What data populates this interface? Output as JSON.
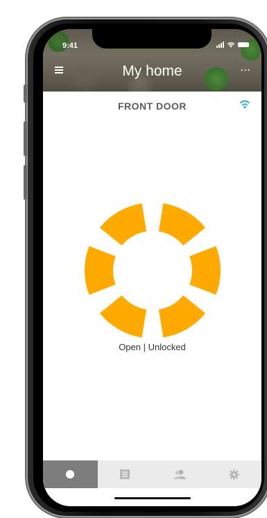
{
  "status_bar": {
    "time": "9:41"
  },
  "header": {
    "title": "My home",
    "menu_icon": "hamburger-menu-icon",
    "more_icon": "more-options-icon",
    "more_glyph": "···"
  },
  "device": {
    "name": "FRONT DOOR",
    "connection_icon": "wifi-icon"
  },
  "lock": {
    "status": "Open | Unlocked",
    "color": "#FFAA00"
  },
  "tabbar": {
    "tabs": [
      {
        "name": "tab-lock",
        "icon": "circle-icon",
        "active": true
      },
      {
        "name": "tab-activity-log",
        "icon": "list-icon",
        "active": false
      },
      {
        "name": "tab-users",
        "icon": "users-icon",
        "active": false
      },
      {
        "name": "tab-settings",
        "icon": "gear-icon",
        "active": false
      }
    ],
    "active_color": "#7D7D7D",
    "inactive_icon_color": "#B5B5B5"
  },
  "colors": {
    "wifi": "#1AA7C6",
    "title_text": "#5B5B5B"
  }
}
